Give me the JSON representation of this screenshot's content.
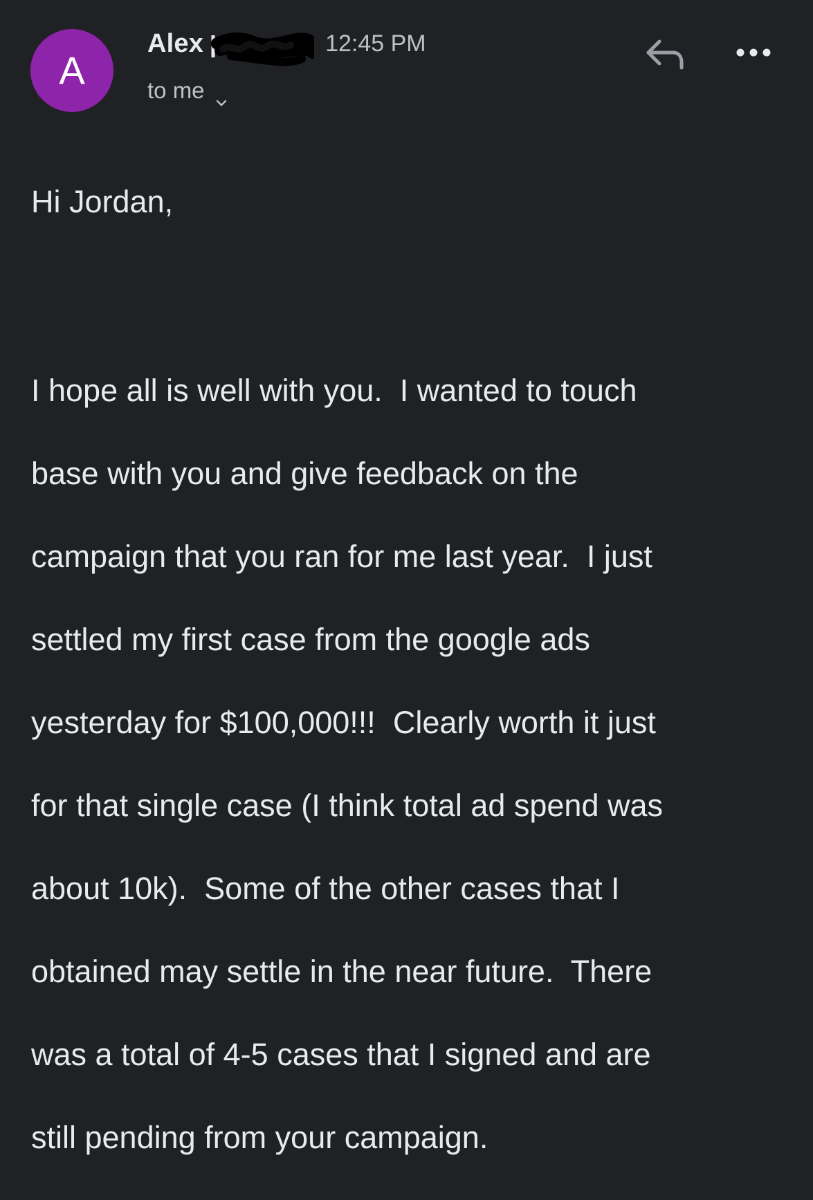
{
  "email": {
    "avatar_letter": "A",
    "sender_name": "Alex",
    "time": "12:45 PM",
    "recipient": "to me",
    "greeting": "Hi Jordan,",
    "body_lines": [
      "I hope all is well with you.  I wanted to touch",
      "base with you and give feedback on the",
      "campaign that you ran for me last year.  I just",
      "settled my first case from the google ads",
      "yesterday for $100,000!!!  Clearly worth it just",
      "for that single case (I think total ad spend was",
      "about 10k).  Some of the other cases that I",
      "obtained may settle in the near future.  There",
      "was a total of 4-5 cases that I signed and are",
      "still pending from your campaign."
    ]
  },
  "icons": {
    "reply": "reply-icon",
    "more": "more-horizontal-icon",
    "chevron": "chevron-down-icon"
  },
  "colors": {
    "background": "#202124",
    "avatar": "#8e24aa",
    "text": "#e8eaed",
    "secondary_text": "#bdc1c6"
  }
}
